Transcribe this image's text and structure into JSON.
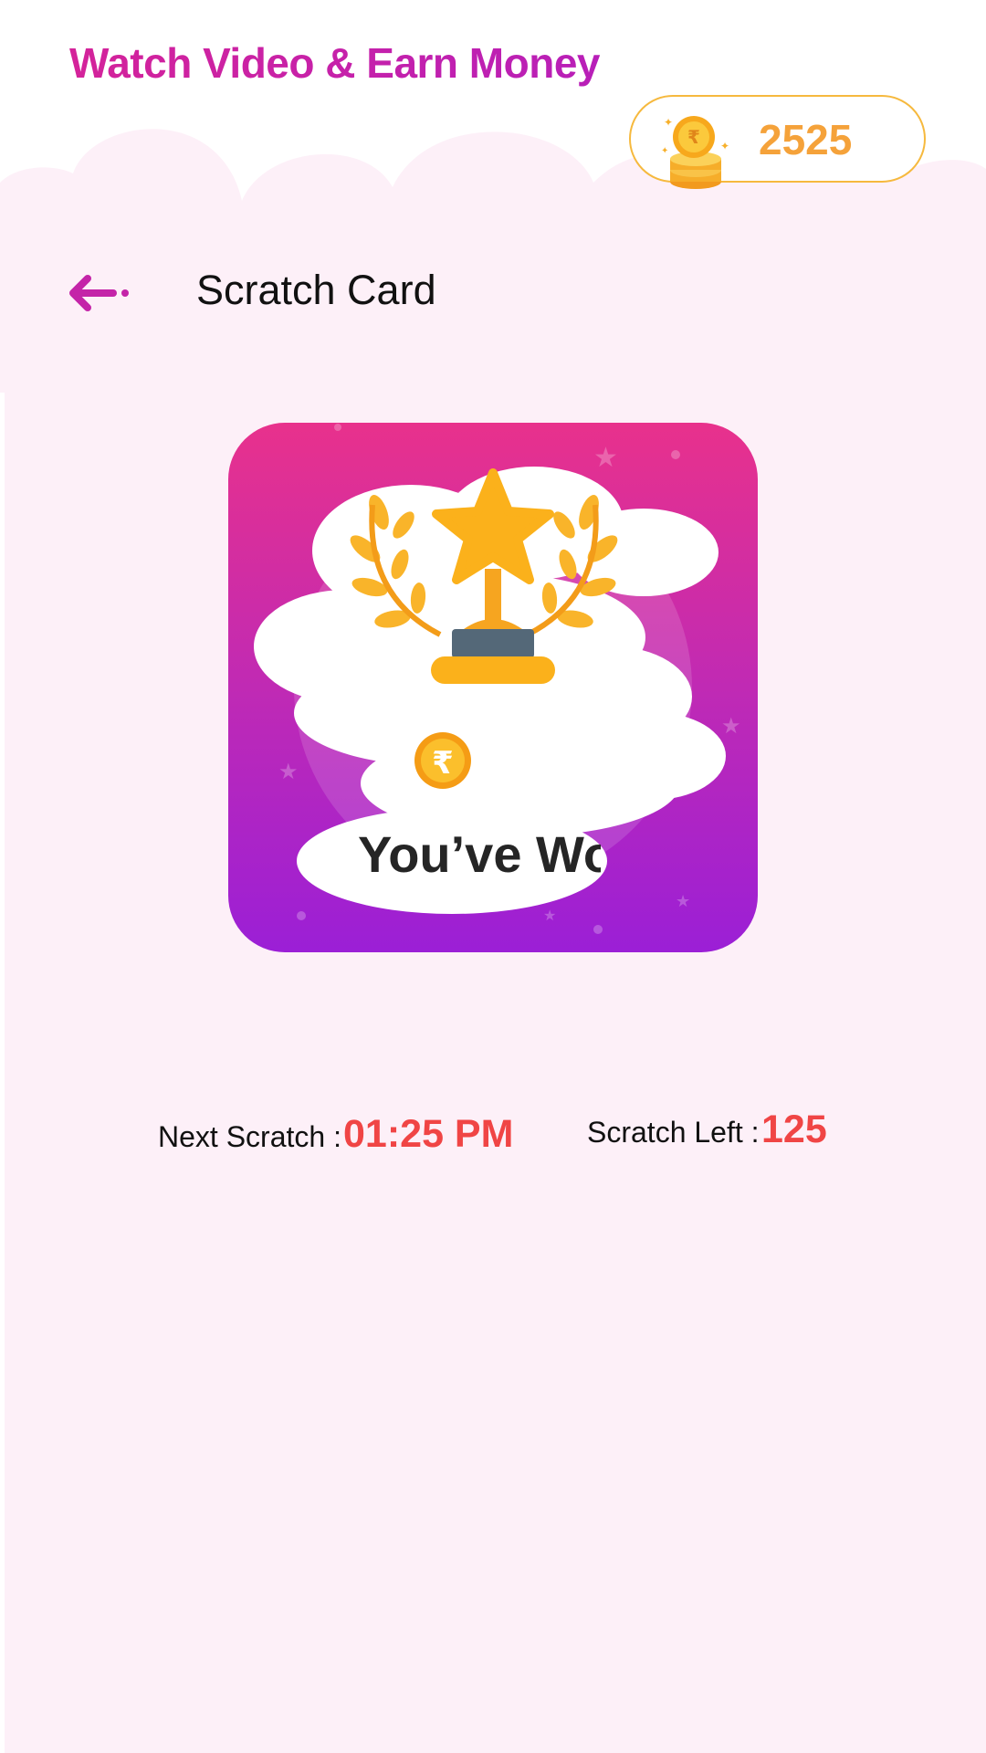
{
  "header": {
    "app_title": "Watch Video & Earn Money",
    "coin_icon": "rupee-coin-stack-icon",
    "coin_balance": "2525"
  },
  "nav": {
    "back_icon": "back-arrow-icon",
    "screen_title": "Scratch Card"
  },
  "scratch_card": {
    "trophy_icon": "trophy-icon",
    "coin_icon": "rupee-coin-icon",
    "revealed_text": "You’ve Wo",
    "colors": {
      "top": "#e8318c",
      "bottom": "#9b1fd6"
    }
  },
  "stats": {
    "next_scratch_label": "Next Scratch :",
    "next_scratch_value": "01:25 PM",
    "scratch_left_label": "Scratch Left :",
    "scratch_left_value": "125"
  },
  "colors": {
    "accent": "#c424a8",
    "highlight": "#f04545",
    "coin": "#f5a23a",
    "background": "#fdf0f8"
  }
}
